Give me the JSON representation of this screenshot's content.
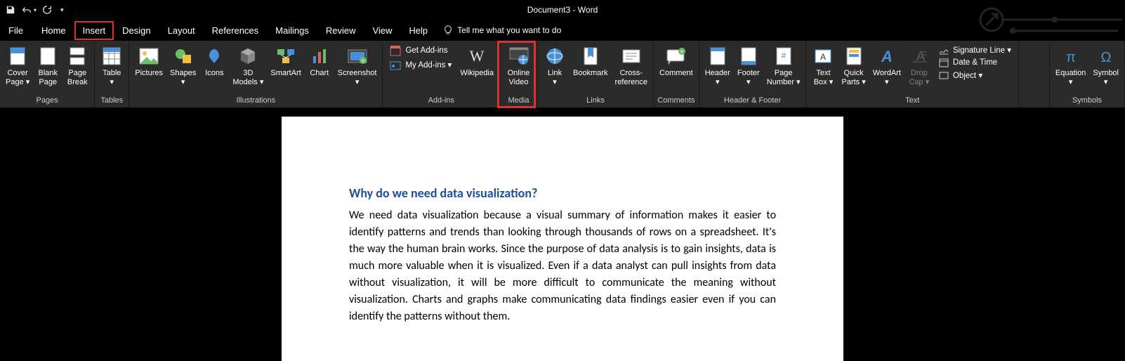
{
  "app": {
    "title": "Document3  -  Word"
  },
  "tabs": {
    "file": "File",
    "home": "Home",
    "insert": "Insert",
    "design": "Design",
    "layout": "Layout",
    "references": "References",
    "mailings": "Mailings",
    "review": "Review",
    "view": "View",
    "help": "Help",
    "tellme": "Tell me what you want to do"
  },
  "ribbon": {
    "pages": {
      "label": "Pages",
      "cover": "Cover\nPage ▾",
      "blank": "Blank\nPage",
      "break": "Page\nBreak"
    },
    "tables": {
      "label": "Tables",
      "table": "Table\n▾"
    },
    "illustrations": {
      "label": "Illustrations",
      "pictures": "Pictures",
      "shapes": "Shapes\n▾",
      "icons": "Icons",
      "models": "3D\nModels ▾",
      "smartart": "SmartArt",
      "chart": "Chart",
      "screenshot": "Screenshot\n▾"
    },
    "addins": {
      "label": "Add-ins",
      "get": "Get Add-ins",
      "my": "My Add-ins  ▾",
      "wikipedia": "Wikipedia"
    },
    "media": {
      "label": "Media",
      "online": "Online\nVideo"
    },
    "links": {
      "label": "Links",
      "link": "Link\n▾",
      "bookmark": "Bookmark",
      "xref": "Cross-\nreference"
    },
    "comments": {
      "label": "Comments",
      "comment": "Comment"
    },
    "headerfooter": {
      "label": "Header & Footer",
      "header": "Header\n▾",
      "footer": "Footer\n▾",
      "pagenum": "Page\nNumber ▾"
    },
    "text": {
      "label": "Text",
      "textbox": "Text\nBox ▾",
      "quickparts": "Quick\nParts ▾",
      "wordart": "WordArt\n▾",
      "dropcap": "Drop\nCap ▾",
      "sigline": "Signature Line  ▾",
      "datetime": "Date & Time",
      "object": "Object  ▾"
    },
    "symbols": {
      "label": "Symbols",
      "equation": "Equation\n▾",
      "symbol": "Symbol\n▾"
    }
  },
  "document": {
    "heading": "Why do we need data visualization?",
    "body": "We need data visualization because a visual summary of information makes it easier to identify patterns and trends than looking through thousands of rows on a spreadsheet. It's the way the human brain works. Since the purpose of data analysis is to gain insights, data is much more valuable when it is visualized. Even if a data analyst can pull insights from data without visualization, it will be more difficult to communicate the meaning without visualization. Charts and graphs make communicating data findings easier even if you can identify the patterns without them."
  }
}
